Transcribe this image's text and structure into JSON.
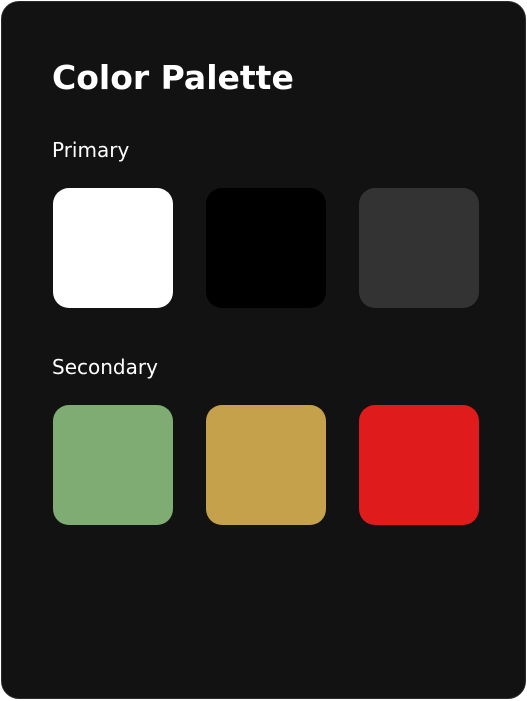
{
  "title": "Color Palette",
  "sections": [
    {
      "label": "Primary",
      "swatches": [
        {
          "color": "#FFFFFF"
        },
        {
          "color": "#000000"
        },
        {
          "color": "#333333"
        }
      ]
    },
    {
      "label": "Secondary",
      "swatches": [
        {
          "color": "#7FAC72"
        },
        {
          "color": "#C6A14C"
        },
        {
          "color": "#E01B1B"
        }
      ]
    }
  ]
}
